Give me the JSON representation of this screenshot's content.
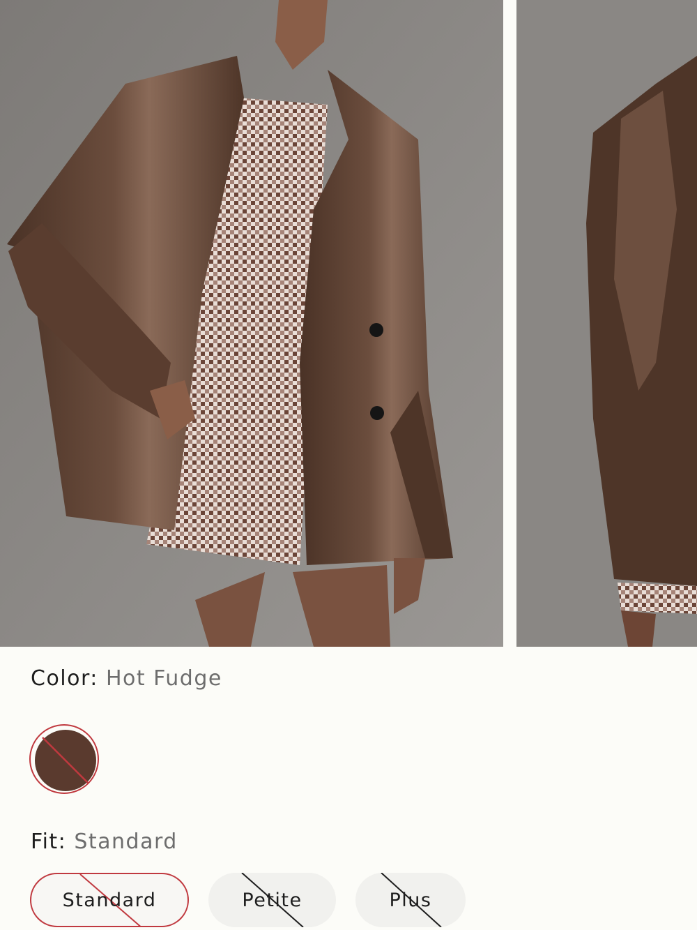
{
  "product": {
    "color": {
      "key_label": "Color:",
      "selected_value": "Hot Fudge",
      "swatch_color": "#5a3a2e",
      "swatch_available": false
    },
    "fit": {
      "key_label": "Fit:",
      "selected_value": "Standard",
      "options": [
        {
          "label": "Standard",
          "selected": true,
          "available": false
        },
        {
          "label": "Petite",
          "selected": false,
          "available": false
        },
        {
          "label": "Plus",
          "selected": false,
          "available": false
        }
      ]
    }
  },
  "colors": {
    "unavailable_slash_selected": "#c0393f",
    "unavailable_slash": "#1d1d1d",
    "jacket": "#5b4032",
    "background": "#85827f"
  }
}
